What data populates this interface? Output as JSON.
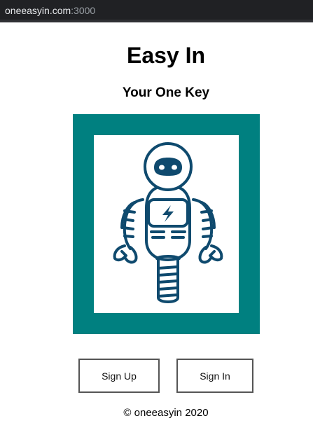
{
  "browser": {
    "url_host": "oneeasyin.com",
    "url_port": ":3000"
  },
  "page": {
    "title": "Easy In",
    "subtitle": "Your One Key"
  },
  "logo": {
    "icon": "robot-icon",
    "frame_color": "#008080",
    "figure_color": "#0f4a6e"
  },
  "buttons": {
    "sign_up": "Sign Up",
    "sign_in": "Sign In"
  },
  "footer": {
    "copyright": "© oneeasyin 2020"
  }
}
